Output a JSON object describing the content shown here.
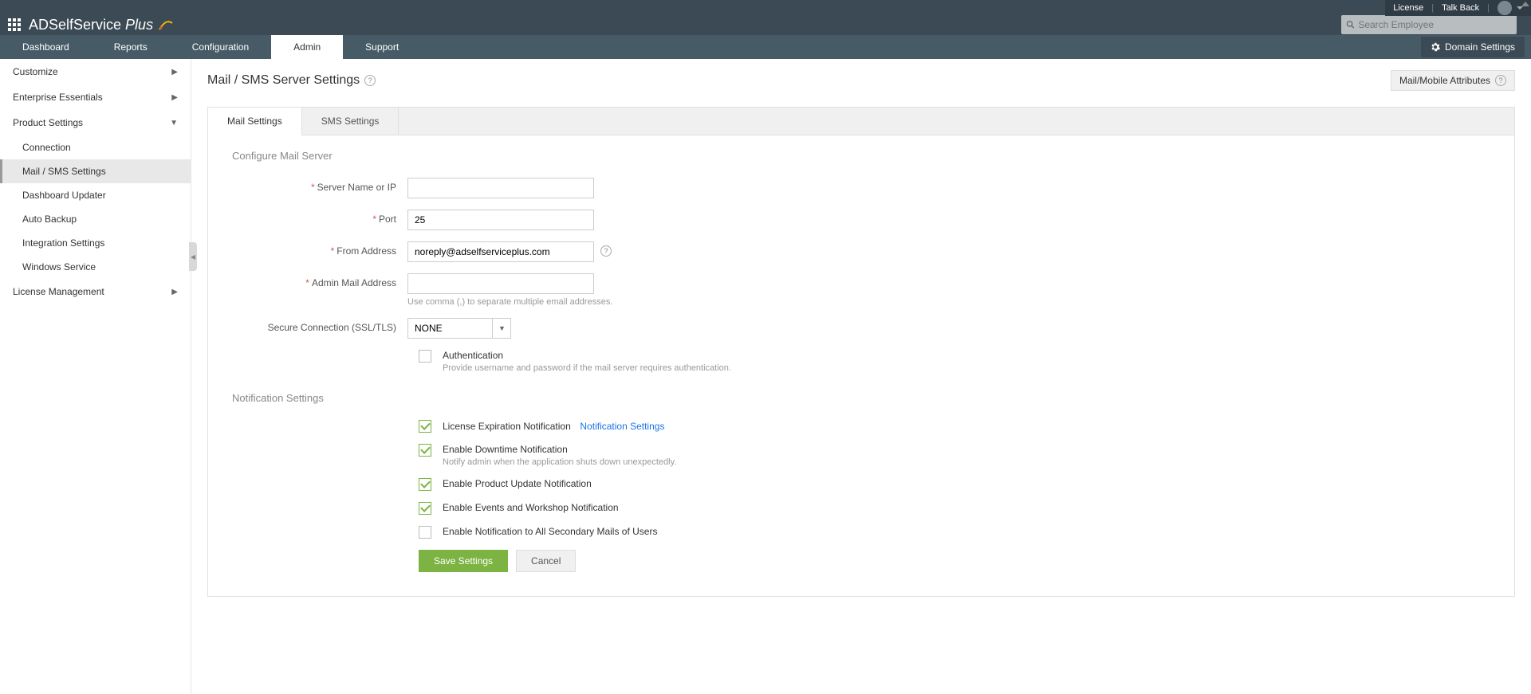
{
  "topLinks": {
    "license": "License",
    "talkback": "Talk Back"
  },
  "app": {
    "name1": "ADSelfService",
    "name2": "Plus"
  },
  "search": {
    "placeholder": "Search Employee"
  },
  "nav": {
    "tabs": [
      "Dashboard",
      "Reports",
      "Configuration",
      "Admin",
      "Support"
    ],
    "domainSettings": "Domain Settings"
  },
  "sidebar": {
    "customize": "Customize",
    "enterprise": "Enterprise Essentials",
    "product": "Product Settings",
    "productSub": [
      "Connection",
      "Mail / SMS Settings",
      "Dashboard Updater",
      "Auto Backup",
      "Integration Settings",
      "Windows Service"
    ],
    "license": "License Management"
  },
  "page": {
    "title": "Mail / SMS Server Settings",
    "mailAttr": "Mail/Mobile Attributes"
  },
  "tabs": {
    "mail": "Mail Settings",
    "sms": "SMS Settings"
  },
  "form": {
    "section1": "Configure Mail Server",
    "serverName": "Server Name or IP",
    "port": "Port",
    "portVal": "25",
    "from": "From Address",
    "fromVal": "noreply@adselfserviceplus.com",
    "admin": "Admin Mail Address",
    "adminHint": "Use comma (,) to separate multiple email addresses.",
    "secure": "Secure Connection (SSL/TLS)",
    "secureVal": "NONE",
    "auth": "Authentication",
    "authHint": "Provide username and password if the mail server requires authentication.",
    "section2": "Notification Settings",
    "licExp": "License Expiration Notification",
    "notifLink": "Notification Settings",
    "downtime": "Enable Downtime Notification",
    "downtimeHint": "Notify admin when the application shuts down unexpectedly.",
    "update": "Enable Product Update Notification",
    "events": "Enable Events and Workshop Notification",
    "secondary": "Enable Notification to All Secondary Mails of Users",
    "save": "Save Settings",
    "cancel": "Cancel"
  }
}
